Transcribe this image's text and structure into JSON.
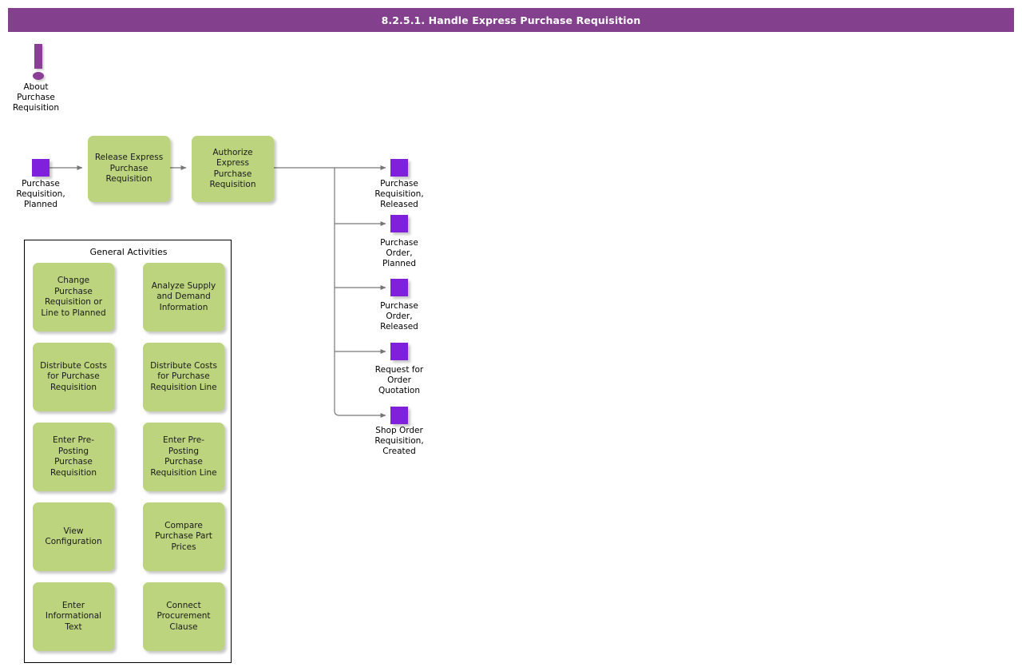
{
  "window": {
    "title": "8.2.5.1. Handle Express Purchase Requisition"
  },
  "about": {
    "icon": "exclamation-icon",
    "label": "About\nPurchase\nRequisition"
  },
  "flow": {
    "start_state": {
      "icon": "state-square",
      "label": "Purchase\nRequisition,\nPlanned"
    },
    "activities": [
      {
        "label": "Release Express\nPurchase\nRequisition"
      },
      {
        "label": "Authorize\nExpress\nPurchase\nRequisition"
      }
    ],
    "end_states": [
      {
        "label": "Purchase\nRequisition,\nReleased"
      },
      {
        "label": "Purchase\nOrder,\nPlanned"
      },
      {
        "label": "Purchase\nOrder,\nReleased"
      },
      {
        "label": "Request for\nOrder\nQuotation"
      },
      {
        "label": "Shop Order\nRequisition,\nCreated"
      }
    ]
  },
  "general_activities": {
    "title": "General Activities",
    "items": [
      {
        "label": "Change\nPurchase\nRequisition or\nLine to Planned"
      },
      {
        "label": "Analyze Supply\nand Demand\nInformation"
      },
      {
        "label": "Distribute Costs\nfor Purchase\nRequisition"
      },
      {
        "label": "Distribute Costs\nfor Purchase\nRequisition Line"
      },
      {
        "label": "Enter Pre-\nPosting\nPurchase\nRequisition"
      },
      {
        "label": "Enter Pre-\nPosting\nPurchase\nRequisition Line"
      },
      {
        "label": "View\nConfiguration"
      },
      {
        "label": "Compare\nPurchase Part\nPrices"
      },
      {
        "label": "Enter\nInformational\nText"
      },
      {
        "label": "Connect\nProcurement\nClause"
      }
    ]
  },
  "colors": {
    "titlebar": "#83418D",
    "activity": "#BCD47E",
    "state": "#7F20DC",
    "icon": "#8B3E96",
    "connector": "#777777"
  }
}
